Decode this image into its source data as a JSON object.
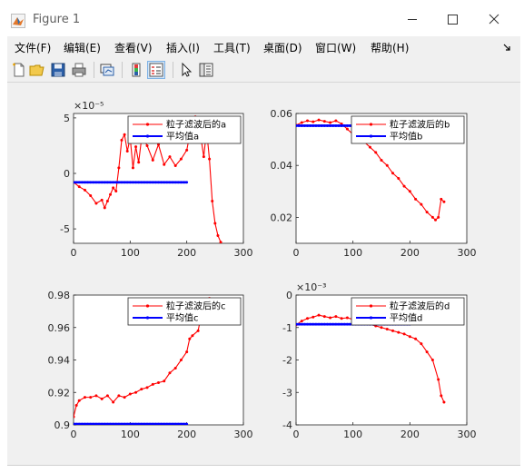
{
  "window": {
    "title": "Figure 1"
  },
  "menu": [
    "文件(F)",
    "编辑(E)",
    "查看(V)",
    "插入(I)",
    "工具(T)",
    "桌面(D)",
    "窗口(W)",
    "帮助(H)"
  ],
  "toolbar": [
    "new-figure-icon",
    "open-folder-icon",
    "save-icon",
    "print-icon",
    "link-plot-icon",
    "colorbar-icon",
    "legend-icon",
    "pointer-icon",
    "property-inspector-icon"
  ],
  "chart_data": [
    {
      "type": "line",
      "exponent_label": "×10⁻⁵",
      "xlim": [
        0,
        300
      ],
      "ylim": [
        -6.3,
        5.4
      ],
      "xticks": [
        0,
        100,
        200,
        300
      ],
      "yticks": [
        -5,
        0,
        5
      ],
      "yticklabels": [
        "-5",
        "0",
        "5"
      ],
      "legend_location": "top-right",
      "series": [
        {
          "name": "粒子滤波后的a",
          "color": "#ff0000",
          "x": [
            0,
            10,
            20,
            30,
            40,
            50,
            55,
            60,
            65,
            70,
            75,
            80,
            85,
            90,
            95,
            100,
            105,
            110,
            115,
            120,
            125,
            130,
            140,
            150,
            160,
            170,
            180,
            190,
            200,
            205,
            210,
            215,
            220,
            225,
            230,
            235,
            240,
            245,
            250,
            255,
            260
          ],
          "y": [
            -0.8,
            -1.2,
            -1.5,
            -2.0,
            -2.7,
            -2.4,
            -3.1,
            -2.5,
            -1.9,
            -1.3,
            -1.6,
            0.5,
            3.0,
            3.5,
            2.0,
            3.2,
            0.5,
            2.4,
            1.0,
            3.1,
            3.0,
            2.5,
            1.2,
            2.6,
            0.8,
            1.5,
            0.7,
            1.3,
            2.1,
            3.4,
            4.2,
            5.1,
            4.1,
            3.2,
            1.5,
            3.9,
            1.3,
            -2.5,
            -4.5,
            -5.6,
            -6.2
          ]
        },
        {
          "name": "平均值a",
          "color": "#0000ff",
          "x": [
            0,
            200
          ],
          "y": [
            -0.8,
            -0.8
          ]
        }
      ]
    },
    {
      "type": "line",
      "exponent_label": "",
      "xlim": [
        0,
        300
      ],
      "ylim": [
        0.01,
        0.06
      ],
      "xticks": [
        0,
        100,
        200,
        300
      ],
      "yticks": [
        0.02,
        0.04,
        0.06
      ],
      "yticklabels": [
        "0.02",
        "0.04",
        "0.06"
      ],
      "legend_location": "top-right",
      "series": [
        {
          "name": "粒子滤波后的b",
          "color": "#ff0000",
          "x": [
            0,
            10,
            20,
            30,
            40,
            50,
            60,
            70,
            80,
            90,
            100,
            110,
            120,
            130,
            140,
            150,
            160,
            170,
            180,
            190,
            200,
            210,
            220,
            230,
            240,
            245,
            250,
            255,
            260
          ],
          "y": [
            0.0555,
            0.0565,
            0.0572,
            0.0568,
            0.0575,
            0.057,
            0.0565,
            0.0572,
            0.056,
            0.054,
            0.052,
            0.051,
            0.049,
            0.047,
            0.045,
            0.042,
            0.04,
            0.037,
            0.035,
            0.032,
            0.03,
            0.027,
            0.025,
            0.022,
            0.02,
            0.019,
            0.02,
            0.027,
            0.026
          ]
        },
        {
          "name": "平均值b",
          "color": "#0000ff",
          "x": [
            0,
            200
          ],
          "y": [
            0.0553,
            0.0553
          ]
        }
      ]
    },
    {
      "type": "line",
      "exponent_label": "",
      "xlim": [
        0,
        300
      ],
      "ylim": [
        0.9,
        0.98
      ],
      "xticks": [
        0,
        100,
        200,
        300
      ],
      "yticks": [
        0.9,
        0.92,
        0.94,
        0.96,
        0.98
      ],
      "yticklabels": [
        "0.9",
        "0.92",
        "0.94",
        "0.96",
        "0.98"
      ],
      "legend_location": "top-right",
      "series": [
        {
          "name": "粒子滤波后的c",
          "color": "#ff0000",
          "x": [
            0,
            5,
            10,
            20,
            30,
            40,
            50,
            60,
            70,
            80,
            90,
            100,
            110,
            120,
            130,
            140,
            150,
            160,
            170,
            180,
            190,
            200,
            205,
            210,
            220,
            230,
            240
          ],
          "y": [
            0.905,
            0.912,
            0.915,
            0.917,
            0.917,
            0.918,
            0.916,
            0.918,
            0.914,
            0.918,
            0.917,
            0.919,
            0.92,
            0.922,
            0.923,
            0.925,
            0.926,
            0.927,
            0.932,
            0.935,
            0.94,
            0.945,
            0.953,
            0.955,
            0.958,
            0.975,
            0.978
          ]
        },
        {
          "name": "平均值c",
          "color": "#0000ff",
          "x": [
            0,
            200
          ],
          "y": [
            0.9005,
            0.9005
          ]
        }
      ]
    },
    {
      "type": "line",
      "exponent_label": "×10⁻³",
      "xlim": [
        0,
        300
      ],
      "ylim": [
        -4,
        0
      ],
      "xticks": [
        0,
        100,
        200,
        300
      ],
      "yticks": [
        -4,
        -3,
        -2,
        -1,
        0
      ],
      "yticklabels": [
        "-4",
        "-3",
        "-2",
        "-1",
        "0"
      ],
      "legend_location": "top-right",
      "series": [
        {
          "name": "粒子滤波后的d",
          "color": "#ff0000",
          "x": [
            0,
            10,
            20,
            30,
            40,
            50,
            60,
            70,
            80,
            90,
            100,
            110,
            120,
            130,
            140,
            150,
            160,
            170,
            180,
            190,
            200,
            210,
            220,
            230,
            240,
            250,
            255,
            260
          ],
          "y": [
            -0.92,
            -0.8,
            -0.72,
            -0.68,
            -0.62,
            -0.66,
            -0.7,
            -0.66,
            -0.72,
            -0.7,
            -0.75,
            -0.8,
            -0.85,
            -0.9,
            -0.95,
            -1.0,
            -1.05,
            -1.1,
            -1.15,
            -1.2,
            -1.28,
            -1.35,
            -1.5,
            -1.75,
            -2.0,
            -2.6,
            -3.1,
            -3.3
          ]
        },
        {
          "name": "平均值d",
          "color": "#0000ff",
          "x": [
            0,
            200
          ],
          "y": [
            -0.9,
            -0.9
          ]
        }
      ]
    }
  ]
}
